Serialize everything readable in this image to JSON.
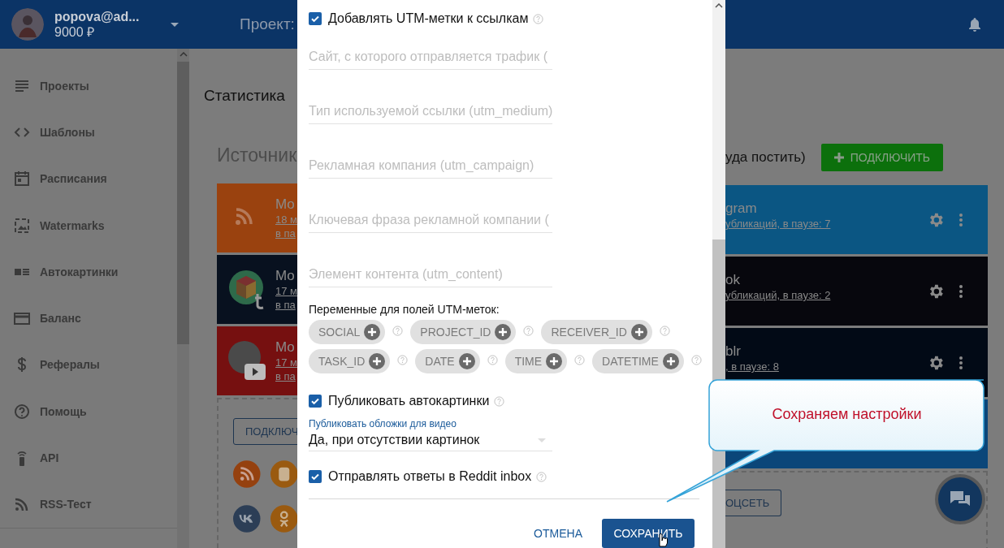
{
  "header": {
    "user": "popova@ad...",
    "balance": "9000 ₽",
    "title": "Проект:"
  },
  "sidebar": {
    "items": [
      {
        "label": "Проекты"
      },
      {
        "label": "Шаблоны"
      },
      {
        "label": "Расписания"
      },
      {
        "label": "Watermarks"
      },
      {
        "label": "Автокартинки"
      },
      {
        "label": "Баланс"
      },
      {
        "label": "Рефералы"
      },
      {
        "label": "Помощь"
      },
      {
        "label": "API"
      },
      {
        "label": "RSS-Тест"
      }
    ]
  },
  "page": {
    "title": "Статистика",
    "section": "Источник",
    "sources": [
      {
        "kind": "rss",
        "color": "#9a420f",
        "name": "Мо",
        "line1": "18 м",
        "line2": "в па"
      },
      {
        "kind": "tumblr",
        "color": "#08111f",
        "name": "Мо",
        "line1": "17 м",
        "line2": "в па"
      },
      {
        "kind": "youtube",
        "color": "#761010",
        "name": "Мо",
        "line1": "17 м",
        "line2": "в па"
      }
    ],
    "connect_button": "ПОДКЛЮЧ"
  },
  "targets": {
    "hint": "уда постить)",
    "connect_button": "ПОДКЛЮЧИТЬ",
    "accounts": [
      {
        "color": "#0b5683",
        "name": "gram",
        "link": "убликаций, в паузе: 7"
      },
      {
        "color": "#07070d",
        "name": "ok",
        "link": "убликаций, в паузе: 2"
      },
      {
        "color": "#020a16",
        "name": "blr",
        "link": ", в паузе: 8"
      },
      {
        "color": "#0b4679"
      }
    ],
    "add_button": "ОЦСЕТЬ"
  },
  "dialog": {
    "utm": {
      "label": "Добавлять UTM-метки к ссылкам",
      "checked": true
    },
    "fields": [
      {
        "placeholder": "Сайт, с которого отправляется трафик ("
      },
      {
        "placeholder": "Тип используемой ссылки (utm_medium)"
      },
      {
        "placeholder": "Рекламная компания (utm_campaign)"
      },
      {
        "placeholder": "Ключевая фраза рекламной компании ("
      },
      {
        "placeholder": "Элемент контента (utm_content)"
      }
    ],
    "variables_label": "Переменные для полей UTM-меток:",
    "variables": [
      [
        "SOCIAL",
        "PROJECT_ID",
        "RECEIVER_ID"
      ],
      [
        "TASK_ID",
        "DATE",
        "TIME",
        "DATETIME"
      ]
    ],
    "autopics": {
      "label": "Публиковать автокартинки",
      "checked": true
    },
    "select": {
      "label": "Публиковать обложки для видео",
      "value": "Да, при отсутствии картинок"
    },
    "reddit": {
      "label": "Отправлять ответы в Reddit inbox",
      "checked": true
    },
    "cancel": "ОТМЕНА",
    "save": "СОХРАНИТЬ"
  },
  "callout": {
    "text": "Сохраняем настройки"
  }
}
